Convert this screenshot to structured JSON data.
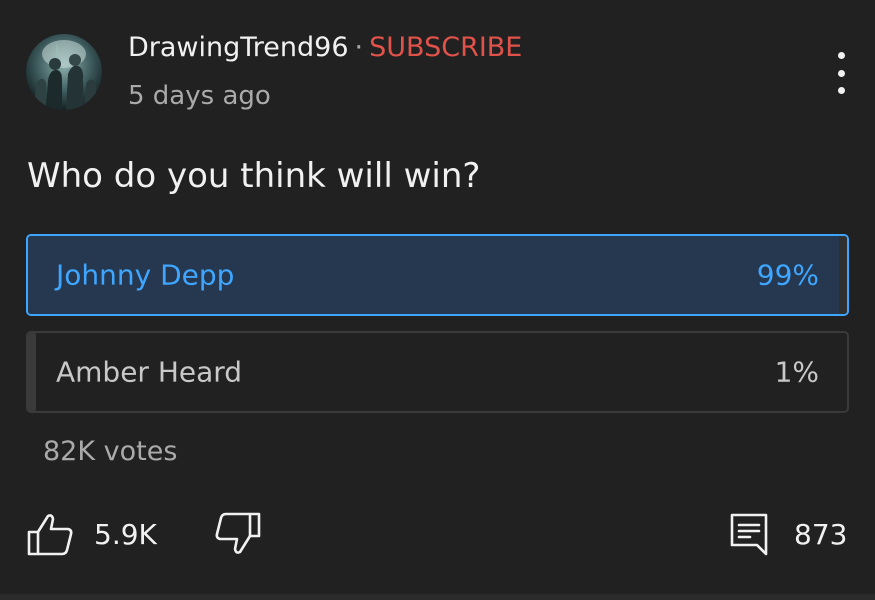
{
  "post": {
    "author": "DrawingTrend96",
    "separator": "·",
    "subscribe_label": "SUBSCRIBE",
    "time_ago": "5 days ago",
    "question": "Who do you think will win?",
    "avatar_icon": "channel-avatar-image",
    "menu_icon": "more-vertical-icon"
  },
  "poll": {
    "options": [
      {
        "label": "Johnny Depp",
        "percent_label": "99%",
        "percent": 99,
        "selected": true
      },
      {
        "label": "Amber Heard",
        "percent_label": "1%",
        "percent": 1,
        "selected": false
      }
    ],
    "votes_label": "82K votes"
  },
  "actions": {
    "like_count": "5.9K",
    "comment_count": "873",
    "like_icon": "thumbs-up-icon",
    "dislike_icon": "thumbs-down-icon",
    "comment_icon": "comment-icon"
  },
  "colors": {
    "background": "#212121",
    "text_primary": "#f1f1f1",
    "text_secondary": "#aaaaaa",
    "subscribe": "#e0524a",
    "selected_accent": "#3ea6ff",
    "selected_fill": "#263850",
    "option_border": "#3a3a3a"
  }
}
